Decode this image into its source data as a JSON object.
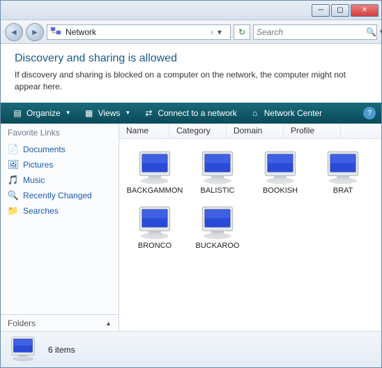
{
  "address": {
    "location": "Network",
    "sep": "›"
  },
  "search": {
    "placeholder": "Search"
  },
  "info": {
    "heading": "Discovery and sharing is allowed",
    "body": "If discovery and sharing is blocked on a computer on the network, the computer might not appear here."
  },
  "cmd": {
    "organize": "Organize",
    "views": "Views",
    "connect": "Connect to a network",
    "center": "Network Center"
  },
  "sidebar": {
    "heading": "Favorite Links",
    "links": [
      "Documents",
      "Pictures",
      "Music",
      "Recently Changed",
      "Searches"
    ],
    "folders": "Folders"
  },
  "columns": {
    "name": "Name",
    "category": "Category",
    "domain": "Domain",
    "profile": "Profile"
  },
  "items": [
    "BACKGAMMON",
    "BALISTIC",
    "BOOKISH",
    "BRAT",
    "BRONCO",
    "BUCKAROO"
  ],
  "details": {
    "count": "6 items"
  }
}
